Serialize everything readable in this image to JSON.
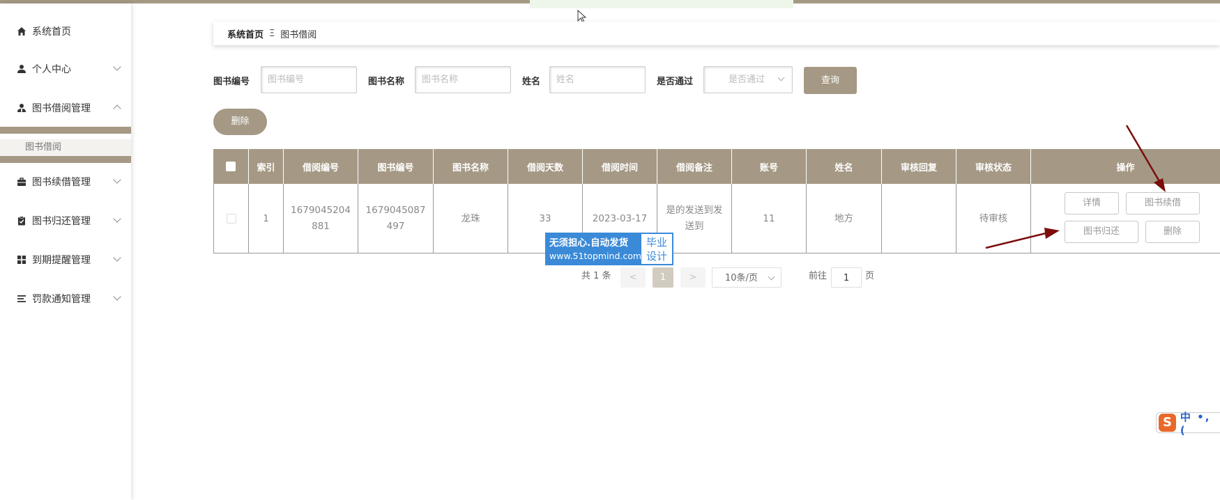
{
  "breadcrumb": {
    "home": "系统首页",
    "separator": "Ξ",
    "current": "图书借阅"
  },
  "sidebar": {
    "items": [
      {
        "label": "系统首页",
        "icon": "home-icon"
      },
      {
        "label": "个人中心",
        "icon": "user-icon"
      },
      {
        "label": "图书借阅管理",
        "icon": "user-tie-icon"
      },
      {
        "label": "图书续借管理",
        "icon": "briefcase-icon"
      },
      {
        "label": "图书归还管理",
        "icon": "clipboard-check-icon"
      },
      {
        "label": "到期提醒管理",
        "icon": "grid-icon"
      },
      {
        "label": "罚款通知管理",
        "icon": "list-icon"
      }
    ],
    "sub_item": "图书借阅"
  },
  "search": {
    "book_no_label": "图书编号",
    "book_no_placeholder": "图书编号",
    "book_name_label": "图书名称",
    "book_name_placeholder": "图书名称",
    "name_label": "姓名",
    "name_placeholder": "姓名",
    "passed_label": "是否通过",
    "passed_placeholder": "是否通过",
    "query_button": "查询"
  },
  "actions": {
    "delete_button": "删除"
  },
  "table": {
    "headers": [
      "索引",
      "借阅编号",
      "图书编号",
      "图书名称",
      "借阅天数",
      "借阅时间",
      "借阅备注",
      "账号",
      "姓名",
      "审核回复",
      "审核状态",
      "操作"
    ],
    "row": {
      "index": "1",
      "borrow_no": "1679045204881",
      "book_no": "1679045087497",
      "book_name": "龙珠",
      "days": "33",
      "time": "2023-03-17",
      "remark": "是的发送到发送到",
      "account": "11",
      "name": "地方",
      "reply": "",
      "status": "待审核"
    },
    "ops": {
      "detail": "详情",
      "renew": "图书续借",
      "return": "图书归还",
      "delete": "删除"
    }
  },
  "watermark": {
    "line1": "无须担心.自动发货",
    "line2": "www.51topmind.com",
    "right": "毕业设计"
  },
  "pagination": {
    "total": "共 1 条",
    "prev": "<",
    "page": "1",
    "next": ">",
    "page_size": "10条/页",
    "goto_label": "前往",
    "goto_value": "1",
    "page_suffix": "页"
  },
  "ime": {
    "logo": "S",
    "text": "中 •, ("
  },
  "colors": {
    "accent": "#a59985",
    "watermark_blue": "#3a8ad8",
    "arrow": "#7b0d0d"
  }
}
